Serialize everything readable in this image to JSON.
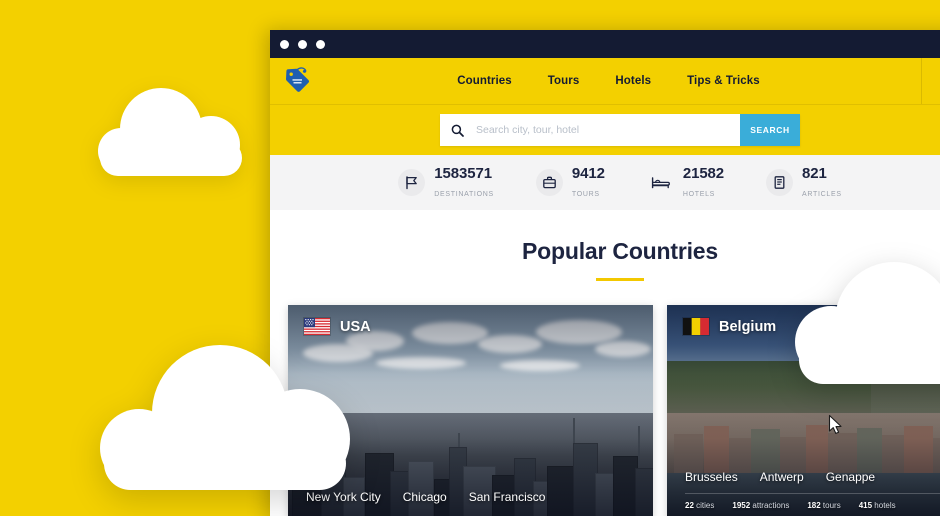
{
  "window": {
    "traffic_lights": [
      "close",
      "minimize",
      "maximize"
    ]
  },
  "header": {
    "logo_name": "price-tag-logo",
    "nav": [
      {
        "label": "Countries"
      },
      {
        "label": "Tours"
      },
      {
        "label": "Hotels"
      },
      {
        "label": "Tips & Tricks"
      }
    ],
    "account_icon": "user-icon"
  },
  "search": {
    "icon": "search-icon",
    "placeholder": "Search city, tour, hotel",
    "value": "",
    "button_label": "SEARCH",
    "button_color": "#3aadd9"
  },
  "stats": [
    {
      "icon": "flag-icon",
      "value": "1583571",
      "label": "DESTINATIONS"
    },
    {
      "icon": "briefcase-icon",
      "value": "9412",
      "label": "TOURS"
    },
    {
      "icon": "bed-icon",
      "value": "21582",
      "label": "HOTELS"
    },
    {
      "icon": "article-icon",
      "value": "821",
      "label": "ARTICLES"
    }
  ],
  "section": {
    "title": "Popular Countries",
    "rule_color": "#f3c800"
  },
  "cards": [
    {
      "country": "USA",
      "flag": "flag-usa",
      "photo": "new-york-skyline",
      "cities": [
        "New York City",
        "Chicago",
        "San Francisco"
      ],
      "meta": []
    },
    {
      "country": "Belgium",
      "flag": "flag-belgium",
      "photo": "dinant-riverside",
      "cities": [
        "Brusseles",
        "Antwerp",
        "Genappe"
      ],
      "meta": [
        {
          "value": "22",
          "label": "cities"
        },
        {
          "value": "1952",
          "label": "attractions"
        },
        {
          "value": "182",
          "label": "tours"
        },
        {
          "value": "415",
          "label": "hotels"
        }
      ]
    }
  ],
  "theme": {
    "background_yellow": "#f3d000",
    "navy": "#141b33",
    "stats_band": "#f4f4f5"
  },
  "decor": {
    "clouds": [
      "cloud-top-left",
      "cloud-bottom-left",
      "cloud-right-edge"
    ],
    "cursor": "pointer-cursor"
  }
}
